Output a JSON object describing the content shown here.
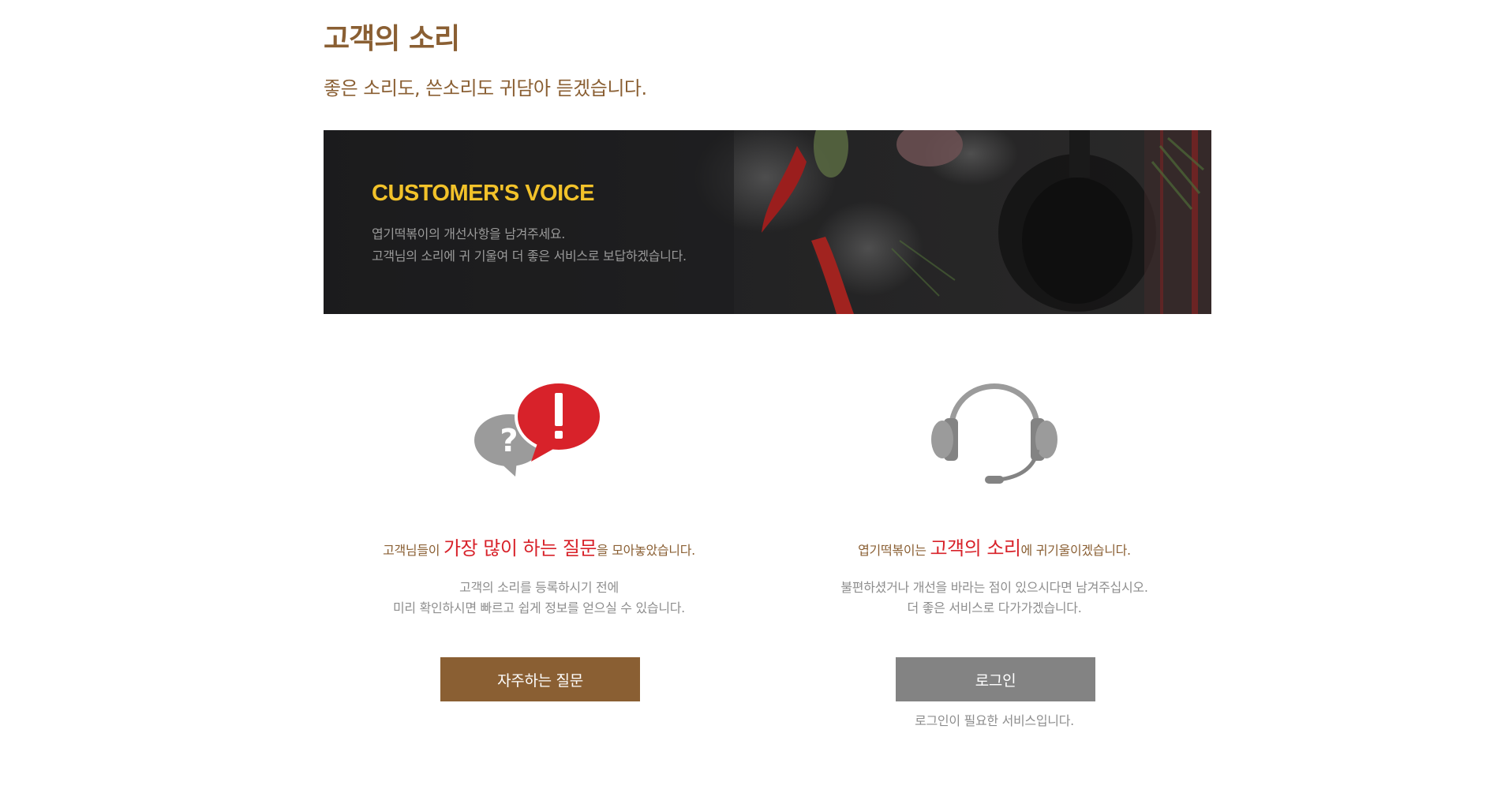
{
  "header": {
    "title": "고객의 소리",
    "subtitle": "좋은 소리도, 쓴소리도 귀담아 듣겠습니다."
  },
  "banner": {
    "title": "CUSTOMER'S VOICE",
    "desc_line1": "엽기떡볶이의 개선사항을 남겨주세요.",
    "desc_line2": "고객님의 소리에 귀 기울여 더 좋은 서비스로 보답하겠습니다."
  },
  "faq_card": {
    "icon": "speech-bubbles-question-exclamation-icon",
    "heading_pre": "고객님들이 ",
    "heading_em": "가장 많이 하는 질문",
    "heading_post": "을 모아놓았습니다.",
    "desc_line1": "고객의 소리를 등록하시기 전에",
    "desc_line2": "미리 확인하시면 빠르고 쉽게 정보를 얻으실 수 있습니다.",
    "button_label": "자주하는 질문"
  },
  "voice_card": {
    "icon": "headset-icon",
    "heading_pre": "엽기떡볶이는 ",
    "heading_em": "고객의 소리",
    "heading_post": "에 귀기울이겠습니다.",
    "desc_line1": "불편하셨거나 개선을 바라는 점이 있으시다면 남겨주십시오.",
    "desc_line2": "더 좋은 서비스로 다가가겠습니다.",
    "button_label": "로그인",
    "note": "로그인이 필요한 서비스입니다."
  },
  "colors": {
    "brand_brown": "#8a5f33",
    "accent_red": "#d8222a",
    "banner_title_yellow": "#f2c22a",
    "login_gray": "#838383"
  }
}
